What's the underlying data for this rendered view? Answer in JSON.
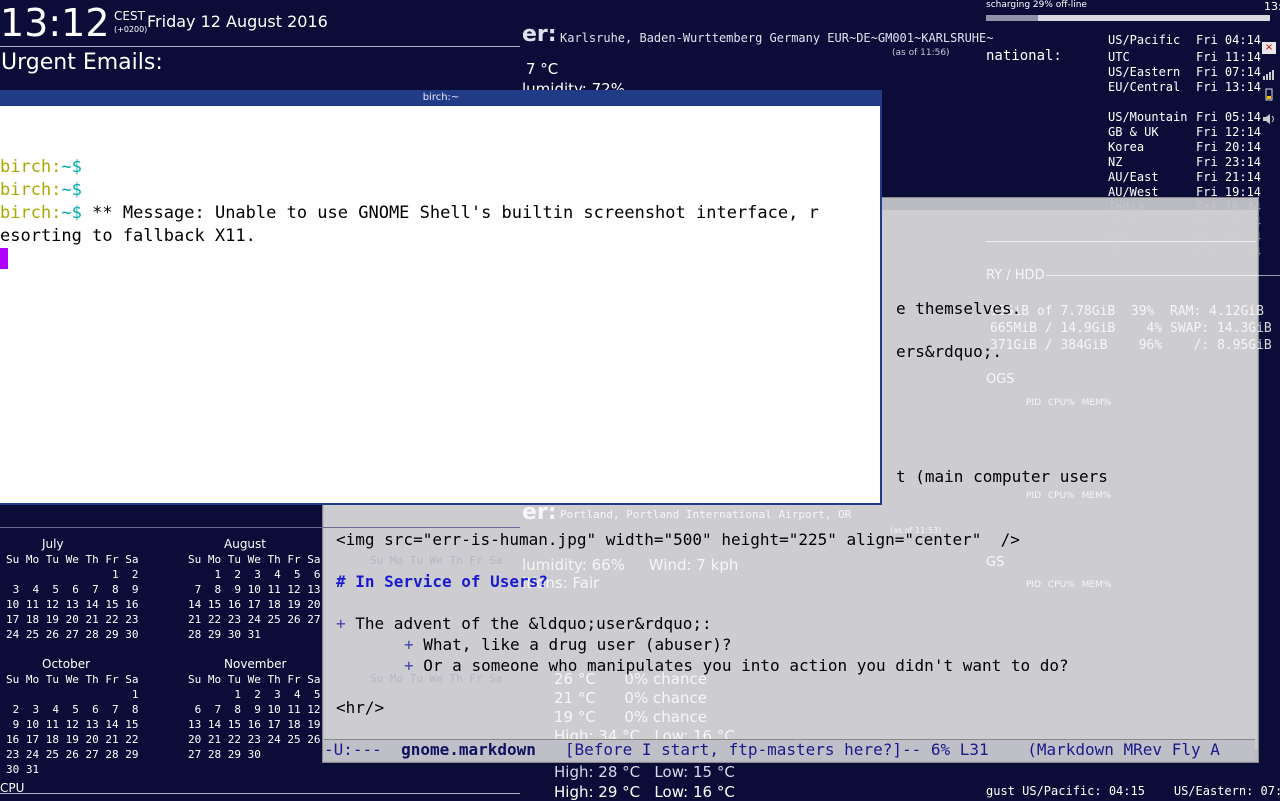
{
  "clock": {
    "time": "13:12",
    "tz": "CEST",
    "tz_offset": "(+0200)",
    "date": "Friday 12 August 2016"
  },
  "urgent_title": "Urgent Emails:",
  "weather_top": {
    "heading": "er:",
    "location": "Karlsruhe, Baden-Wurttemberg Germany EUR~DE~GM001~KARLSRUHE~",
    "as_of": "(as of 11:56)",
    "temp": "7 °C",
    "humidity": "lumidity: 72%"
  },
  "battery": {
    "text": "scharging 29% off-line",
    "percent": 29,
    "corner_clock": "13:"
  },
  "intl_label": "national:",
  "world_clocks": [
    {
      "zone": "US/Pacific",
      "time": "Fri 04:14"
    },
    {
      "zone": "UTC",
      "time": "Fri 11:14"
    },
    {
      "zone": "US/Eastern",
      "time": "Fri 07:14"
    },
    {
      "zone": "EU/Central",
      "time": "Fri 13:14"
    },
    {
      "zone": "US/Mountain",
      "time": "Fri 05:14"
    },
    {
      "zone": "GB & UK",
      "time": "Fri 12:14"
    },
    {
      "zone": "Korea",
      "time": "Fri 20:14"
    },
    {
      "zone": "NZ",
      "time": "Fri 23:14"
    },
    {
      "zone": "AU/East",
      "time": "Fri 21:14"
    },
    {
      "zone": "AU/West",
      "time": "Fri 19:14"
    },
    {
      "zone": "India",
      "time": "Fri 16:44"
    },
    {
      "zone": "Japan",
      "time": "Fri 20:14"
    },
    {
      "zone": "BRT",
      "time": "Fri 08:14"
    },
    {
      "zone": "ZA",
      "time": "Fri 13:14"
    }
  ],
  "memory": {
    "heading": "RY / HDD",
    "lines": [
      "95GiB of 7.78GiB  39%  RAM: 4.12GiB",
      "665MiB / 14.9GiB    4% SWAP: 14.3GiB",
      "371GiB / 384GiB    96%    /: 8.95GiB"
    ],
    "logs_heading": "OGS",
    "gs_heading": "GS",
    "proc_header": "PID  CPU% MEM%"
  },
  "editor": {
    "frag1": "e themselves.",
    "frag2": "ers&rdquo;.",
    "frag3": "t (main computer users",
    "img_line": "<img src=\"err-is-human.jpg\" width=\"500\" height=\"225\" align=\"center\"  />",
    "heading": "# In Service of Users?",
    "bullet1_mark": "+",
    "bullet1": " The advent of the &ldquo;user&rdquo;:",
    "sub1_mark": "+",
    "sub1": " What, like a drug user (abuser)?",
    "sub2_mark": "+",
    "sub2": " Or a someone who manipulates you into action you didn't want to do?",
    "hr": "<hr/>"
  },
  "modeline": {
    "status": "-U:---  ",
    "buffer": "gnome.markdown",
    "middle": "   [Before I start, ftp-masters here?]-- 6% L31    (Markdown MRev Fly A"
  },
  "terminal": {
    "title": "birch:~",
    "host": "birch:",
    "tilde": "~$",
    "msg1": " ** Message: Unable to use GNOME Shell's builtin screenshot interface, r",
    "msg2": "esorting to fallback X11."
  },
  "weather_bg": {
    "heading": "er:",
    "location": "Portland, Portland International Airport, OR",
    "as_of": "(as of 11:53)",
    "humidity": "lumidity: 66%     Wind: 7 kph",
    "conditions": "itions: Fair",
    "forecast": [
      "26 °C      0% chance",
      "21 °C      0% chance",
      "19 °C      0% chance"
    ],
    "high1": "High: 34 °C   Low: 16 °C",
    "high2": "High: 28 °C   Low: 15 °C",
    "high3": "High: 29 °C   Low: 16 °C"
  },
  "calendar": {
    "weekdays": "Su Mo Tu We Th Fr Sa",
    "months": [
      {
        "name": "July",
        "rows": [
          "                1  2",
          " 3  4  5  6  7  8  9",
          "10 11 12 13 14 15 16",
          "17 18 19 20 21 22 23",
          "24 25 26 27 28 29 30"
        ]
      },
      {
        "name": "August",
        "rows": [
          "    1  2  3  4  5  6",
          " 7  8  9 10 11 12 13",
          "14 15 16 17 18 19 20",
          "21 22 23 24 25 26 27",
          "28 29 30 31"
        ]
      },
      {
        "name": "October",
        "rows": [
          "                   1",
          " 2  3  4  5  6  7  8",
          " 9 10 11 12 13 14 15",
          "16 17 18 19 20 21 22",
          "23 24 25 26 27 28 29",
          "30 31"
        ]
      },
      {
        "name": "November",
        "rows": [
          "       1  2  3  4  5",
          " 6  7  8  9 10 11 12",
          "13 14 15 16 17 18 19",
          "20 21 22 23 24 25 26",
          "27 28 29 30"
        ]
      }
    ]
  },
  "cpu_label": "CPU",
  "bottom_right": "gust US/Pacific: 04:15    US/Eastern: 07:15"
}
